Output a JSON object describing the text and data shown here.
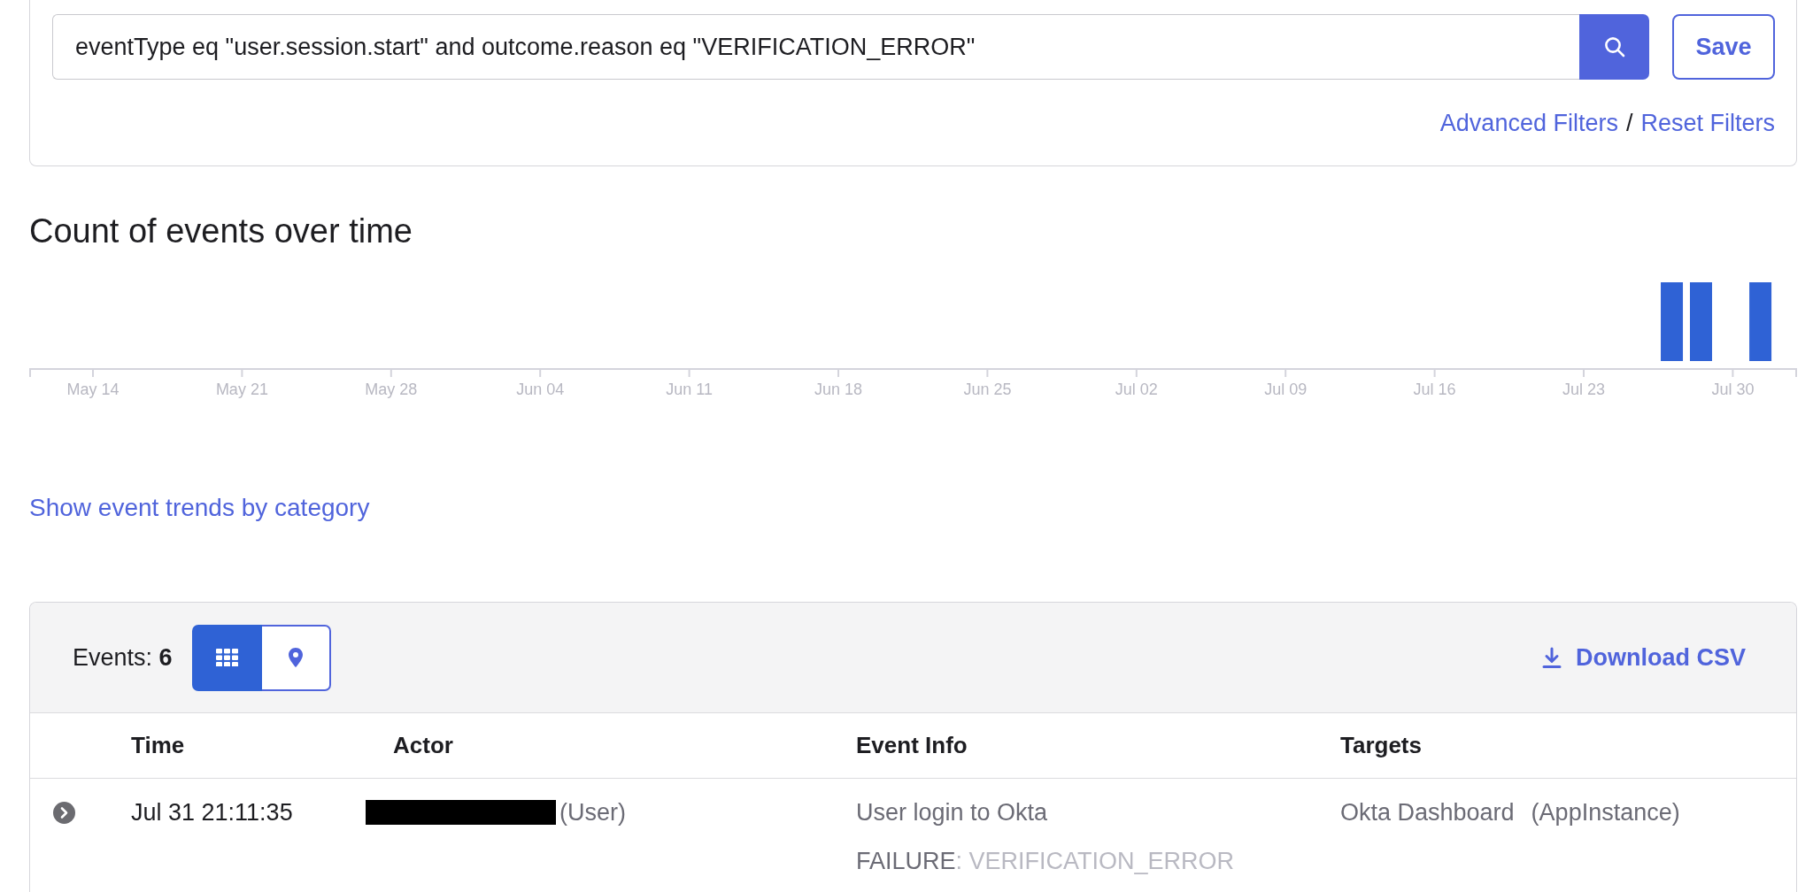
{
  "filter": {
    "query": "eventType eq \"user.session.start\" and outcome.reason eq \"VERIFICATION_ERROR\"",
    "save_button": "Save",
    "links": [
      "Advanced Filters",
      "Reset Filters"
    ],
    "link_separator": "/"
  },
  "chart": {
    "title": "Count of events over time",
    "x_axis_labels": [
      "May 14",
      "May 21",
      "May 28",
      "Jun 04",
      "Jun 11",
      "Jun 18",
      "Jun 25",
      "Jul 02",
      "Jul 09",
      "Jul 16",
      "Jul 23",
      "Jul 30"
    ]
  },
  "trends_link": "Show event trends by category",
  "events": {
    "count": "Events: **6**",
    "views": [
      {
        "kind": "grid",
        "selected": true
      },
      {
        "kind": "map",
        "selected": false
      }
    ],
    "download_button": "Download CSV",
    "table": {
      "columns": [
        "Time",
        "Actor",
        "Event Info",
        "Targets"
      ],
      "rows": [
        {
          "expanded": false,
          "time": "Jul 31 21:11:35",
          "actor": {
            "redacted": true,
            "type": "(User)"
          },
          "event_info": {
            "title": "User login to Okta",
            "outcome": "FAILURE",
            "reason": ": VERIFICATION_ERROR"
          },
          "targets": [
            {
              "name": "Okta Dashboard",
              "type": "(AppInstance)"
            }
          ]
        }
      ]
    }
  }
}
